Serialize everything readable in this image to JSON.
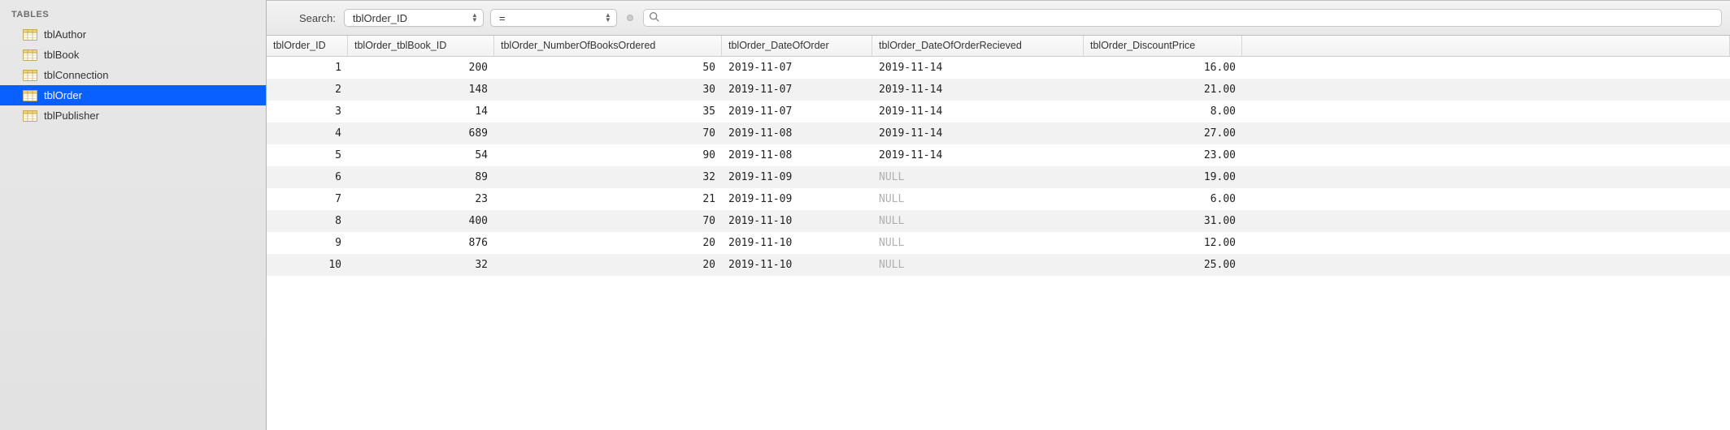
{
  "sidebar": {
    "header": "TABLES",
    "items": [
      {
        "label": "tblAuthor",
        "selected": false
      },
      {
        "label": "tblBook",
        "selected": false
      },
      {
        "label": "tblConnection",
        "selected": false
      },
      {
        "label": "tblOrder",
        "selected": true
      },
      {
        "label": "tblPublisher",
        "selected": false
      }
    ]
  },
  "toolbar": {
    "search_label": "Search:",
    "field_select": "tblOrder_ID",
    "op_select": "=",
    "search_value": ""
  },
  "grid": {
    "columns": [
      "tblOrder_ID",
      "tblOrder_tblBook_ID",
      "tblOrder_NumberOfBooksOrdered",
      "tblOrder_DateOfOrder",
      "tblOrder_DateOfOrderRecieved",
      "tblOrder_DiscountPrice"
    ],
    "rows": [
      {
        "id": "1",
        "book": "200",
        "num": "50",
        "date": "2019-11-07",
        "recv": "2019-11-14",
        "price": "16.00"
      },
      {
        "id": "2",
        "book": "148",
        "num": "30",
        "date": "2019-11-07",
        "recv": "2019-11-14",
        "price": "21.00"
      },
      {
        "id": "3",
        "book": "14",
        "num": "35",
        "date": "2019-11-07",
        "recv": "2019-11-14",
        "price": "8.00"
      },
      {
        "id": "4",
        "book": "689",
        "num": "70",
        "date": "2019-11-08",
        "recv": "2019-11-14",
        "price": "27.00"
      },
      {
        "id": "5",
        "book": "54",
        "num": "90",
        "date": "2019-11-08",
        "recv": "2019-11-14",
        "price": "23.00"
      },
      {
        "id": "6",
        "book": "89",
        "num": "32",
        "date": "2019-11-09",
        "recv": "NULL",
        "price": "19.00"
      },
      {
        "id": "7",
        "book": "23",
        "num": "21",
        "date": "2019-11-09",
        "recv": "NULL",
        "price": "6.00"
      },
      {
        "id": "8",
        "book": "400",
        "num": "70",
        "date": "2019-11-10",
        "recv": "NULL",
        "price": "31.00"
      },
      {
        "id": "9",
        "book": "876",
        "num": "20",
        "date": "2019-11-10",
        "recv": "NULL",
        "price": "12.00"
      },
      {
        "id": "10",
        "book": "32",
        "num": "20",
        "date": "2019-11-10",
        "recv": "NULL",
        "price": "25.00"
      }
    ]
  }
}
